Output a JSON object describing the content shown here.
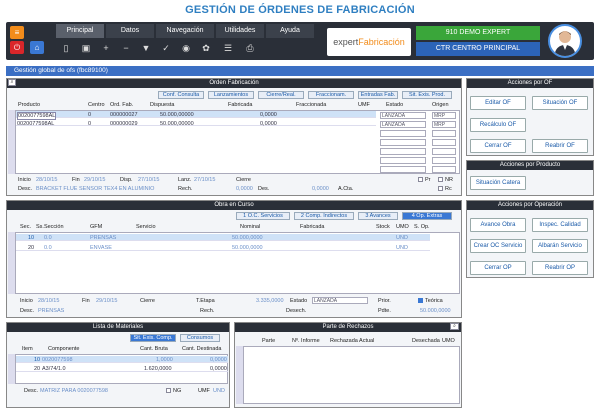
{
  "app": {
    "title": "GESTIÓN DE ÓRDENES DE FABRICACIÓN",
    "logo_a": "expert",
    "logo_b": "Fabricación",
    "company": "910 DEMO EXPERT",
    "center": "CTR CENTRO PRINCIPAL"
  },
  "tabs": [
    "Principal",
    "Datos",
    "Navegación",
    "Utilidades",
    "Ayuda"
  ],
  "window_title": "Gestión global de ofs (fbc89100)",
  "orden": {
    "title": "Orden Fabricación",
    "links": [
      "Conf. Consulta",
      "Lanzamientos",
      "Cierre/Real.",
      "Fraccionam.",
      "Entradas Fab.",
      "Sit. Exis. Prod."
    ],
    "cols": [
      "Producto",
      "Centro",
      "Ord. Fab.",
      "Dispuesta",
      "Fabricada",
      "Fraccionada",
      "UMF",
      "Estado",
      "Origen"
    ],
    "rows": [
      {
        "producto": "0020077598AL",
        "centro": "0",
        "of": "000000027",
        "disp": "50.000,00000",
        "fab": "0,0000",
        "estado": "LANZADA",
        "origen": "MRP"
      },
      {
        "producto": "0020077598AL",
        "centro": "0",
        "of": "000000029",
        "disp": "50.000,00000",
        "fab": "0,0000",
        "estado": "LANZADA",
        "origen": "MRP"
      }
    ],
    "inicio_l": "Inicio",
    "inicio": "28/10/15",
    "fin_l": "Fin",
    "fin": "29/10/15",
    "disp_l": "Disp.",
    "disp": "27/10/15",
    "lanz_l": "Lanz.",
    "lanz": "27/10/15",
    "cierre_l": "Cierre",
    "pr": "Pr",
    "nr": "NR",
    "desc_l": "Desc.",
    "desc": "BRACKET FLUE SENSOR TEX4 EN ALUMINIO",
    "rech_l": "Rech.",
    "rech": "0,0000",
    "des_l": "Des.",
    "des": "0,0000",
    "acta": "A.Cta.",
    "rc": "Rc"
  },
  "acciones_of": {
    "title": "Acciones por OF",
    "buttons": [
      "Editar OF",
      "Situación OF",
      "Recálculo OF",
      "Cerrar OF",
      "Reabrir OF"
    ]
  },
  "acciones_prod": {
    "title": "Acciones por Producto",
    "buttons": [
      "Situación Catera"
    ]
  },
  "acciones_op": {
    "title": "Acciones por Operación",
    "buttons": [
      "Avance Obra",
      "Inspec. Calidad",
      "Crear OC Servicio",
      "Albarán Servicio",
      "Cerrar OP",
      "Reabrir OP"
    ]
  },
  "obra": {
    "title": "Obra en Curso",
    "links": [
      "1 O.C. Servicios",
      "2 Comp. Indirectos",
      "3 Avances",
      "4 Op. Extras"
    ],
    "cols": [
      "Sec.",
      "Ss.Sección",
      "GFM",
      "Servicio",
      "Nominal",
      "Fabricada",
      "Stock",
      "UMO",
      "S. Op."
    ],
    "rows": [
      {
        "sec": "10",
        "ss": "0.0",
        "gfm": "PRENSAS",
        "nominal": "50.000,0000",
        "umo": "UND"
      },
      {
        "sec": "20",
        "ss": "0.0",
        "gfm": "ENVASE",
        "nominal": "50.000,0000",
        "umo": "UND"
      }
    ],
    "inicio_l": "Inicio",
    "inicio": "28/10/15",
    "fin_l": "Fin",
    "fin": "29/10/15",
    "cierre_l": "Cierre",
    "tetapa_l": "T.Etapa",
    "tetapa": "3.335,0000",
    "estado_l": "Estado",
    "estado": "LANZADA",
    "prior_l": "Prior.",
    "teorica": "Teórica",
    "desc_l": "Desc.",
    "desc": "PRENSAS",
    "rech_l": "Rech.",
    "desech_l": "Desech.",
    "pdte_l": "Pdte.",
    "pdte": "50.000,0000"
  },
  "materiales": {
    "title": "Lista de Materiales",
    "links": [
      "Sit. Exis. Comp.",
      "Consumos"
    ],
    "cols": [
      "Item",
      "Componente",
      "Cant. Bruta",
      "Cant. Destinada"
    ],
    "rows": [
      {
        "item": "10",
        "comp": "0020077598",
        "bruta": "1,0000",
        "dest": "0,0000"
      },
      {
        "item": "20",
        "comp": "A3/74/1.0",
        "bruta": "1.620,0000",
        "dest": "0,0000"
      }
    ],
    "desc_l": "Desc.",
    "desc": "MATRIZ PARA 0020077598",
    "ng": "NG",
    "umf_l": "UMF",
    "umf": "UND"
  },
  "rechazos": {
    "title": "Parte de Rechazos",
    "cols": [
      "Parte",
      "Nº. Informe",
      "Rechazada Actual",
      "Desechada",
      "UMO"
    ]
  },
  "colors": {
    "accent": "#2c64b8",
    "green": "#3aa63a",
    "dark": "#2a2f38"
  }
}
